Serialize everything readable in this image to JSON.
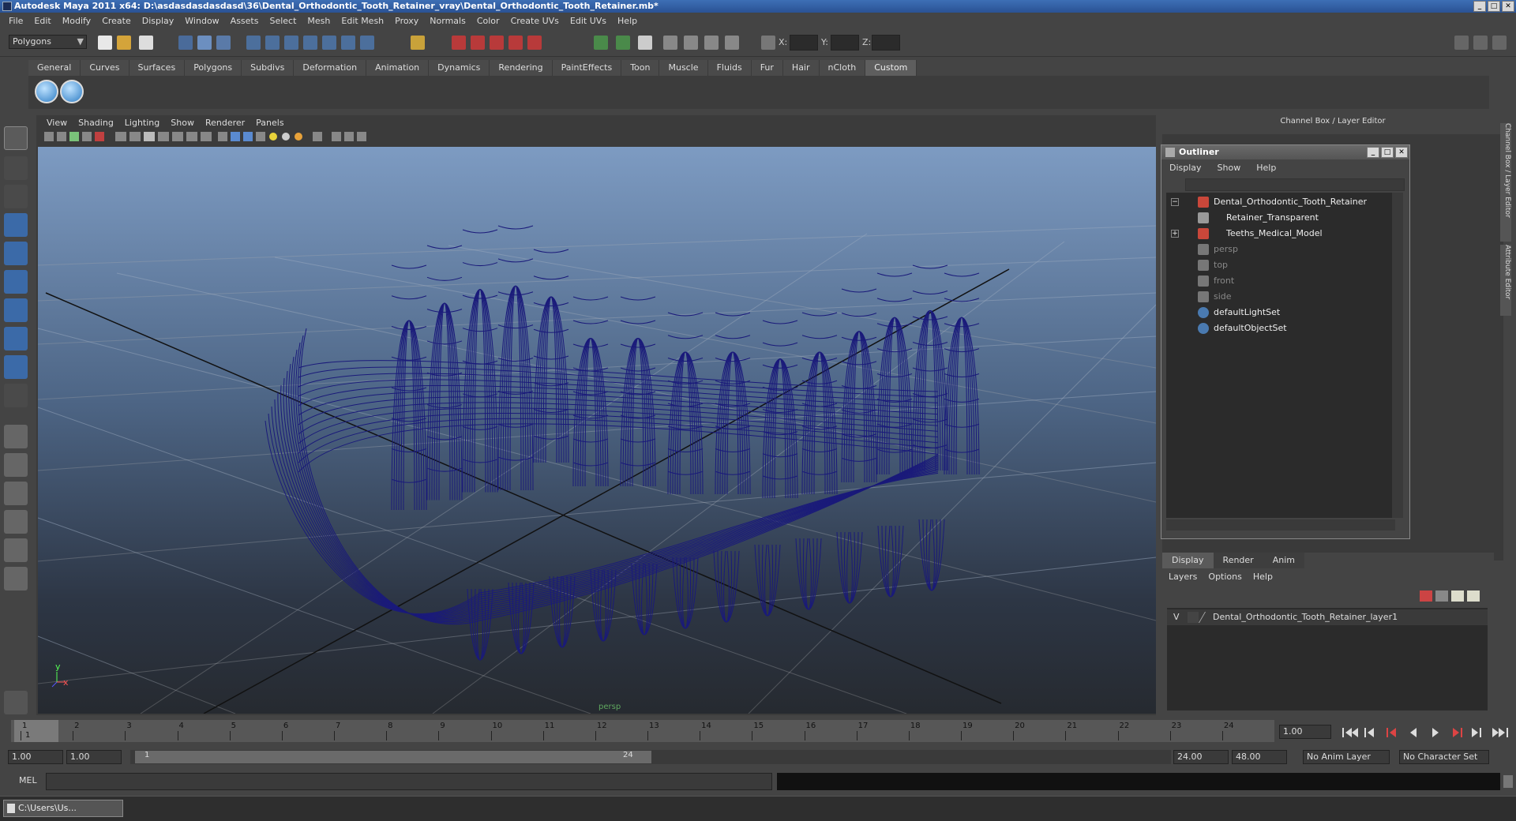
{
  "window": {
    "title": "Autodesk Maya 2011 x64: D:\\asdasdasdasdasd\\36\\Dental_Orthodontic_Tooth_Retainer_vray\\Dental_Orthodontic_Tooth_Retainer.mb*",
    "min": "_",
    "max": "□",
    "close": "✕"
  },
  "menubar": [
    "File",
    "Edit",
    "Modify",
    "Create",
    "Display",
    "Window",
    "Assets",
    "Select",
    "Mesh",
    "Edit Mesh",
    "Proxy",
    "Normals",
    "Color",
    "Create UVs",
    "Edit UVs",
    "Help"
  ],
  "status": {
    "mode": "Polygons",
    "x_label": "X:",
    "y_label": "Y:",
    "z_label": "Z:"
  },
  "shelf": {
    "tabs": [
      "General",
      "Curves",
      "Surfaces",
      "Polygons",
      "Subdivs",
      "Deformation",
      "Animation",
      "Dynamics",
      "Rendering",
      "PaintEffects",
      "Toon",
      "Muscle",
      "Fluids",
      "Fur",
      "Hair",
      "nCloth",
      "Custom"
    ],
    "active": "Custom"
  },
  "viewport": {
    "menu": [
      "View",
      "Shading",
      "Lighting",
      "Show",
      "Renderer",
      "Panels"
    ],
    "camera_label": "persp",
    "axis_y": "y",
    "axis_x": "x",
    "wire_color": "#1a1a7a"
  },
  "channelbox": {
    "title": "Channel Box / Layer Editor",
    "side_tab1": "Channel Box / Layer Editor",
    "side_tab2": "Attribute Editor"
  },
  "outliner": {
    "title": "Outliner",
    "menu": [
      "Display",
      "Show",
      "Help"
    ],
    "items": [
      {
        "label": "Dental_Orthodontic_Tooth_Retainer",
        "dim": false
      },
      {
        "label": "Retainer_Transparent",
        "dim": false
      },
      {
        "label": "Teeths_Medical_Model",
        "dim": false
      },
      {
        "label": "persp",
        "dim": true
      },
      {
        "label": "top",
        "dim": true
      },
      {
        "label": "front",
        "dim": true
      },
      {
        "label": "side",
        "dim": true
      },
      {
        "label": "defaultLightSet",
        "dim": false
      },
      {
        "label": "defaultObjectSet",
        "dim": false
      }
    ]
  },
  "layers": {
    "tabs": [
      "Display",
      "Render",
      "Anim"
    ],
    "active": "Display",
    "menu": [
      "Layers",
      "Options",
      "Help"
    ],
    "row": {
      "vis": "V",
      "name": "Dental_Orthodontic_Tooth_Retainer_layer1"
    }
  },
  "timeline": {
    "ticks": [
      "1",
      "2",
      "3",
      "4",
      "5",
      "6",
      "7",
      "8",
      "9",
      "10",
      "11",
      "12",
      "13",
      "14",
      "15",
      "16",
      "17",
      "18",
      "19",
      "20",
      "21",
      "22",
      "23",
      "24"
    ],
    "current": "1.00",
    "current_frame": "1"
  },
  "range": {
    "start": "1.00",
    "start2": "1.00",
    "slider_start": "1",
    "slider_end": "24",
    "end": "24.00",
    "end2": "48.00",
    "anim_layer": "No Anim Layer",
    "char_set": "No Character Set"
  },
  "cmdline": {
    "label": "MEL"
  },
  "taskbar": {
    "item": "C:\\Users\\Us..."
  }
}
